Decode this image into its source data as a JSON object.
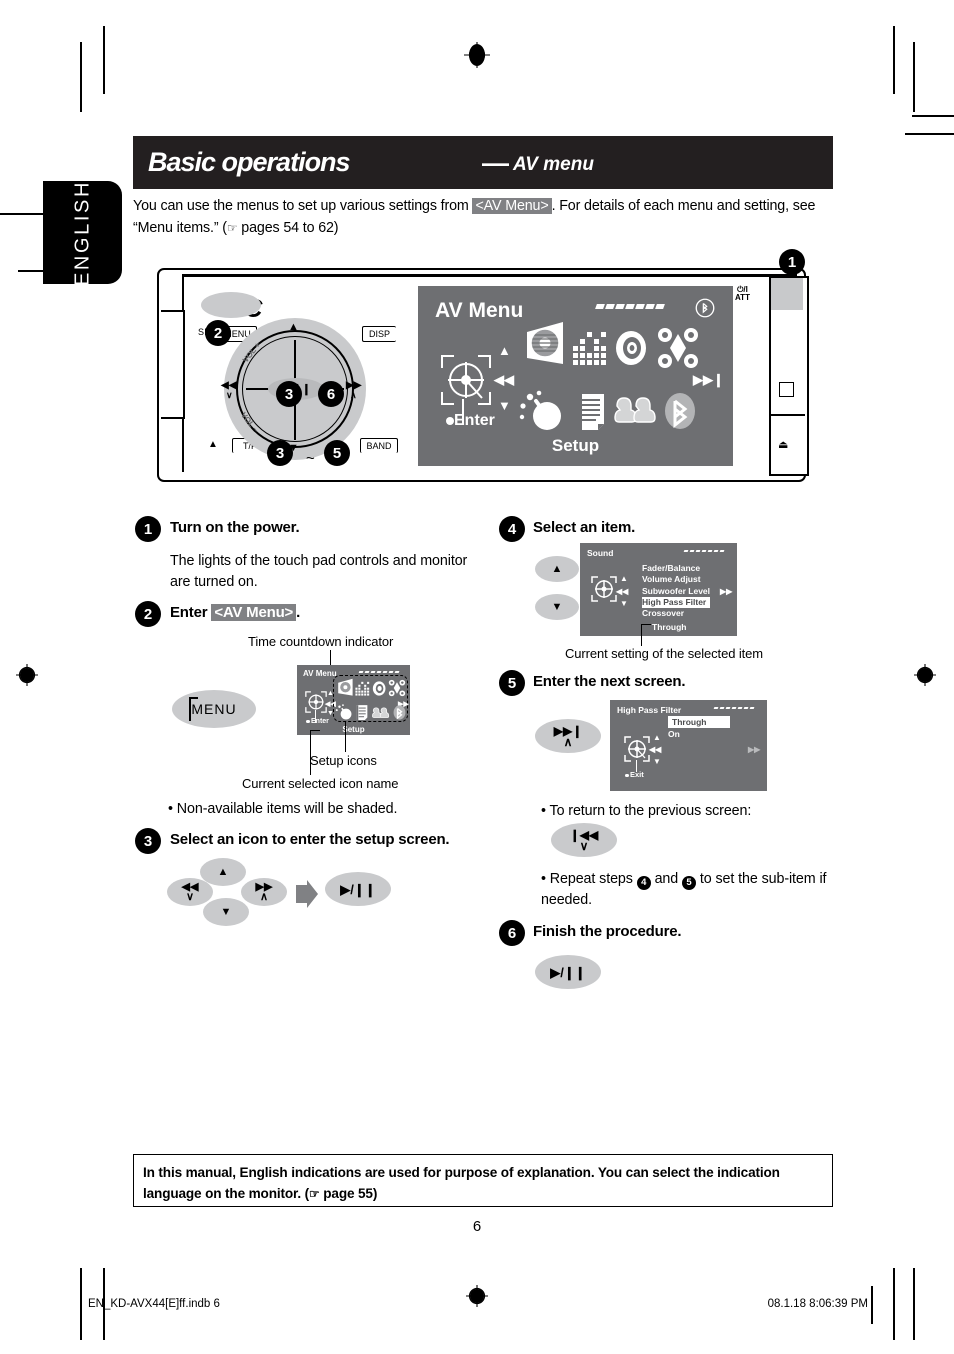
{
  "language_tab": "ENGLISH",
  "title": {
    "main": "Basic operations",
    "dash": "—",
    "sub": "AV menu"
  },
  "intro": {
    "part1": "You can use the menus to set up various settings from ",
    "chip": "<AV Menu>",
    "part2": ". For details of each menu and setting, see “Menu items.” (",
    "hand_icon": "☞",
    "part3": " pages 54 to 62)"
  },
  "unit": {
    "brand": "JVC",
    "src_label": "SRC",
    "menu_label": "MENU",
    "disp_label": "DISP",
    "tp_label": "T/P",
    "band_label": "BAND",
    "vol_plus": "VOL +",
    "vol_minus": "VOL −",
    "play_pause": "▶/❙❙",
    "prev_glyph": "◀◀",
    "next_glyph": "▶▶",
    "up_glyph": "▲",
    "down_glyph": "▼",
    "eject_glyph": "▲",
    "power_line1": "⏻/I",
    "power_line2": "ATT",
    "tilde": "~",
    "callouts": {
      "c1": "1",
      "c2": "2",
      "c3a": "3",
      "c3b": "3",
      "c5": "5",
      "c6": "6"
    }
  },
  "lcd_main": {
    "title": "AV Menu",
    "enter": "Enter",
    "setup": "Setup",
    "bluetooth_top_icon": "bluetooth-icon",
    "countdown_segments": 7,
    "icons": [
      {
        "name": "gear-icon",
        "label": "Setup"
      },
      {
        "name": "equalizer-icon",
        "label": "Equalizer"
      },
      {
        "name": "speaker-icon",
        "label": "Sound"
      },
      {
        "name": "surround-icon",
        "label": "Surround"
      },
      {
        "name": "dimmer-icon",
        "label": "Dimmer"
      },
      {
        "name": "list-icon",
        "label": "Mode"
      },
      {
        "name": "seats-icon",
        "label": "Position"
      },
      {
        "name": "bluetooth-icon",
        "label": "Bluetooth"
      }
    ]
  },
  "steps": {
    "s1": {
      "num": "1",
      "head": "Turn on the power.",
      "body": "The lights of the touch pad controls and monitor are turned on."
    },
    "s2": {
      "num": "2",
      "head_pre": "Enter ",
      "head_chip": "<AV Menu>",
      "head_post": ".",
      "caption_top": "Time countdown indicator",
      "caption_icons": "Setup icons",
      "caption_name": "Current selected icon name",
      "menu_button": "MENU",
      "bullet": "•  Non-available items will be shaded.",
      "lcd": {
        "title": "AV Menu",
        "enter": "Enter",
        "setup": "Setup"
      }
    },
    "s3": {
      "num": "3",
      "head": "Select an icon to enter the setup screen.",
      "btn_prev": "◀◀",
      "btn_prev_sub": "∨",
      "btn_up": "▲",
      "btn_down": "▼",
      "btn_next": "▶▶",
      "btn_next_sub": "∧",
      "btn_play": "▶/❙❙"
    },
    "s4": {
      "num": "4",
      "head": "Select an item.",
      "btn_up": "▲",
      "btn_down": "▼",
      "caption": "Current setting of the selected item",
      "lcd": {
        "title": "Sound",
        "items": [
          "Fader/Balance",
          "Volume Adjust",
          "Subwoofer Level",
          "High Pass Filter",
          "Crossover"
        ],
        "selected_index": 3,
        "current_setting": "Through"
      }
    },
    "s5": {
      "num": "5",
      "head": "Enter the next screen.",
      "btn_next": "▶▶❙",
      "btn_next_sub": "∧",
      "lcd": {
        "title": "High Pass Filter",
        "items": [
          "Through",
          "On"
        ],
        "selected_index": 0,
        "exit": "Exit"
      },
      "bullet1": "•  To return to the previous screen:",
      "btn_back": "❙◀◀",
      "btn_back_sub": "∨",
      "bullet2_a": "•  Repeat steps ",
      "bullet2_n1": "4",
      "bullet2_b": " and ",
      "bullet2_n2": "5",
      "bullet2_c": " to set the sub-item if needed."
    },
    "s6": {
      "num": "6",
      "head": "Finish the procedure.",
      "btn_play": "▶/❙❙"
    }
  },
  "note": {
    "line1": "In this manual, English indications are used for purpose of explanation. You can select the indication",
    "line2_a": "language on the monitor. (",
    "hand_icon": "☞",
    "line2_b": " page 55)"
  },
  "page_number": "6",
  "footer": {
    "file": "EN_KD-AVX44[E]ff.indb   6",
    "timestamp": "08.1.18   8:06:39 PM"
  },
  "colors": {
    "title_bar": "#231f20",
    "lcd_bg": "#6e6f72",
    "pad_grey": "#c9cacc",
    "chip_grey": "#808184"
  }
}
